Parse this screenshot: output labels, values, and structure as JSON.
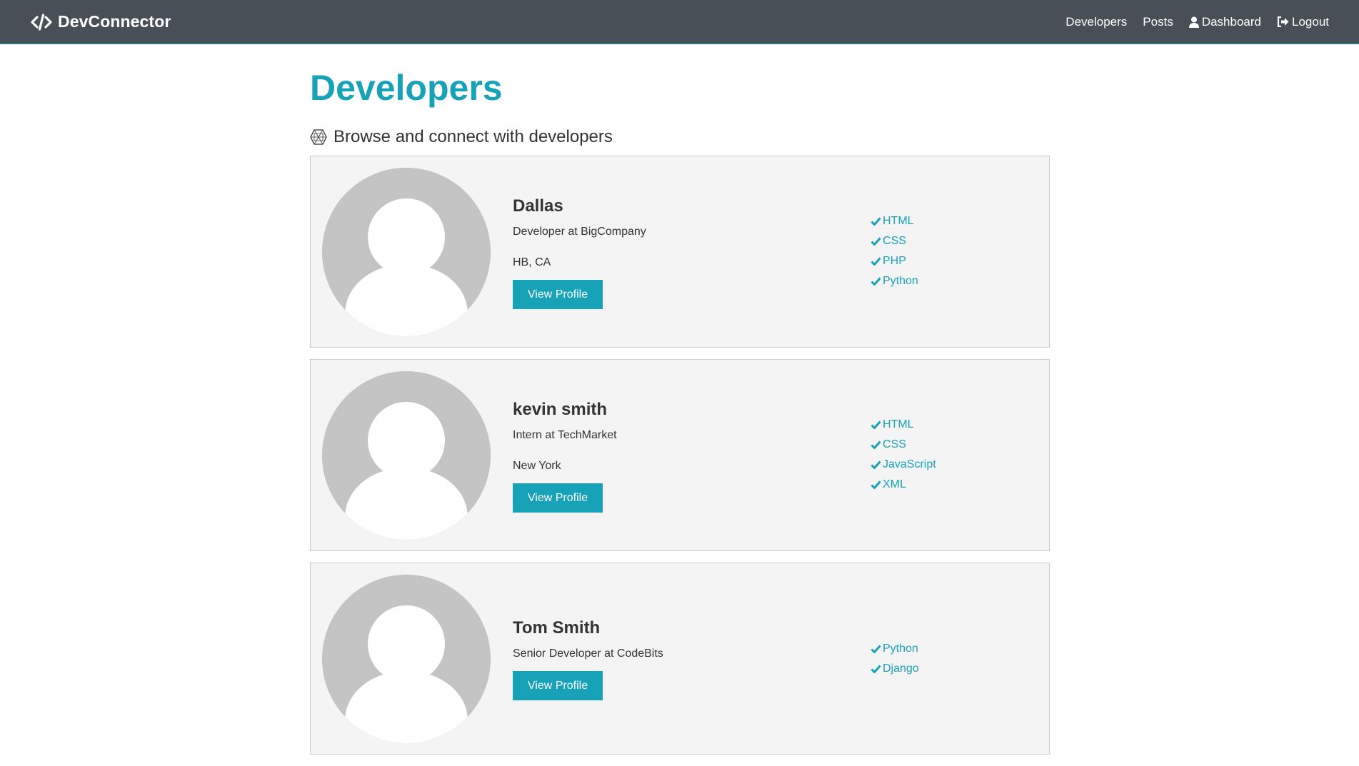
{
  "navbar": {
    "brand": "DevConnector",
    "brand_icon": "code-icon",
    "links": [
      {
        "label": "Developers"
      },
      {
        "label": "Posts"
      },
      {
        "label": "Dashboard",
        "icon": "user-icon"
      },
      {
        "label": "Logout",
        "icon": "sign-out-icon"
      }
    ]
  },
  "main": {
    "title": "Developers",
    "lead": "Browse and connect with developers",
    "lead_icon": "connectdevelop-icon",
    "profiles": [
      {
        "name": "Dallas",
        "status": "Developer at BigCompany",
        "location": "HB, CA",
        "button": "View Profile",
        "skills": [
          "HTML",
          "CSS",
          "PHP",
          "Python"
        ]
      },
      {
        "name": "kevin smith",
        "status": "Intern at TechMarket",
        "location": "New York",
        "button": "View Profile",
        "skills": [
          "HTML",
          "CSS",
          "JavaScript",
          "XML"
        ]
      },
      {
        "name": "Tom Smith",
        "status": "Senior Developer at CodeBits",
        "location": "",
        "button": "View Profile",
        "skills": [
          "Python",
          "Django"
        ]
      }
    ]
  },
  "colors": {
    "navbar": "#484f56",
    "primary": "#17a2b8",
    "card_bg": "#f4f4f4",
    "avatar_bg": "#c4c4c4"
  }
}
